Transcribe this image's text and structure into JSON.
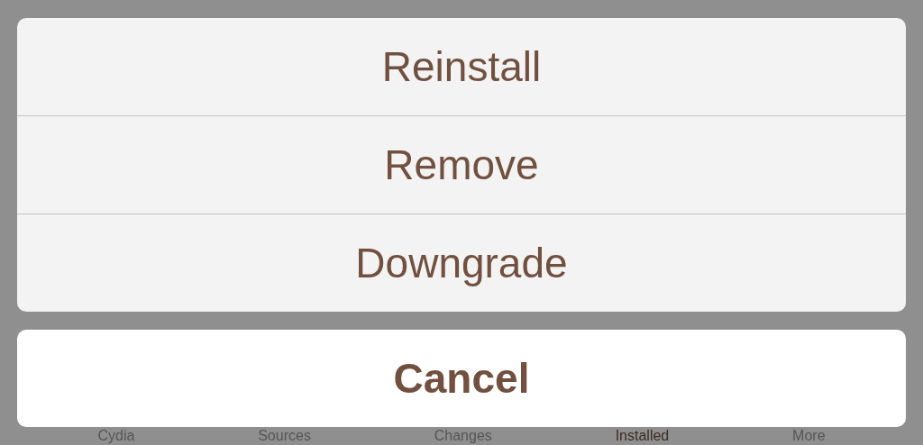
{
  "action_sheet": {
    "actions": [
      {
        "label": "Reinstall"
      },
      {
        "label": "Remove"
      },
      {
        "label": "Downgrade"
      }
    ],
    "cancel": "Cancel"
  },
  "tab_bar": {
    "tabs": [
      {
        "label": "Cydia",
        "selected": false
      },
      {
        "label": "Sources",
        "selected": false
      },
      {
        "label": "Changes",
        "selected": false
      },
      {
        "label": "Installed",
        "selected": true
      },
      {
        "label": "More",
        "selected": false
      }
    ]
  }
}
